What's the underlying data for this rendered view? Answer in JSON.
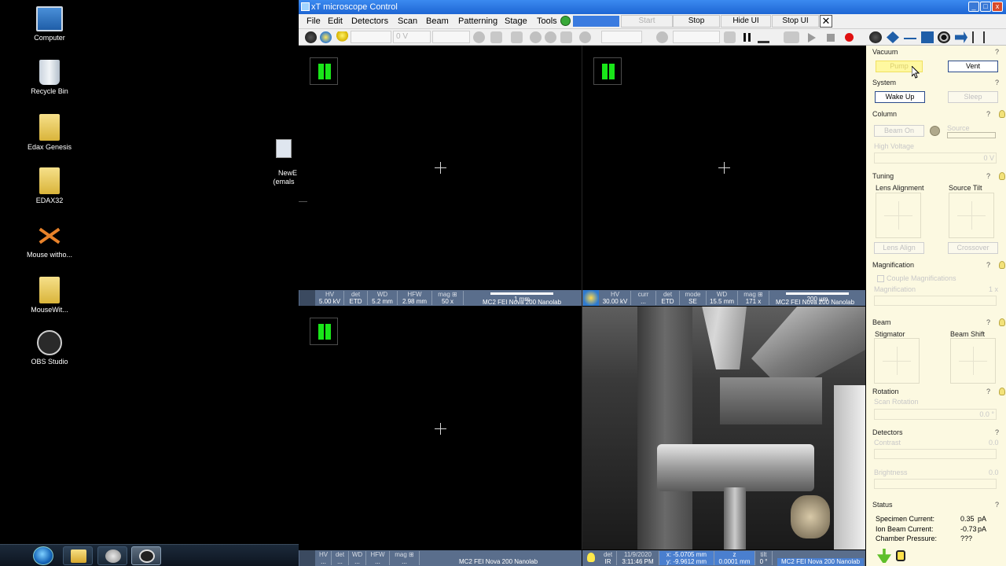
{
  "desktop": {
    "icons": [
      {
        "label": "Computer"
      },
      {
        "label": "Recycle Bin"
      },
      {
        "label": "Edax Genesis"
      },
      {
        "label": "EDAX32"
      },
      {
        "label": "Mouse witho..."
      },
      {
        "label": "MouseWit..."
      },
      {
        "label": "OBS Studio"
      }
    ],
    "partial_icon_label": "NewE\n(emals"
  },
  "window": {
    "title": "xT microscope Control"
  },
  "menu": {
    "items": [
      "File",
      "Edit",
      "Detectors",
      "Scan",
      "Beam",
      "Patterning",
      "Stage",
      "Tools"
    ],
    "buttons": [
      "Start",
      "Stop",
      "Hide UI",
      "Stop UI"
    ],
    "close": "✕"
  },
  "toolbar": {
    "hv_value": "0 V"
  },
  "quad1": {
    "databar": [
      {
        "k": "HV",
        "v": "5.00 kV"
      },
      {
        "k": "det",
        "v": "ETD"
      },
      {
        "k": "WD",
        "v": "5.2 mm"
      },
      {
        "k": "HFW",
        "v": "2.98 mm"
      },
      {
        "k": "mag ⊞",
        "v": "50 x"
      }
    ],
    "scale": "1 mm",
    "name": "MC2 FEI Nova 200 Nanolab"
  },
  "quad2": {
    "databar": [
      {
        "k": "HV",
        "v": "30.00 kV"
      },
      {
        "k": "curr",
        "v": "..."
      },
      {
        "k": "det",
        "v": "ETD"
      },
      {
        "k": "mode",
        "v": "SE"
      },
      {
        "k": "WD",
        "v": "15.5 mm"
      },
      {
        "k": "mag ⊞",
        "v": "171 x"
      }
    ],
    "scale": "200 µm",
    "name": "MC2 FEI Nova 200 Nanolab"
  },
  "quad3": {
    "databar": [
      {
        "k": "HV",
        "v": "..."
      },
      {
        "k": "det",
        "v": "..."
      },
      {
        "k": "WD",
        "v": "..."
      },
      {
        "k": "HFW",
        "v": "..."
      },
      {
        "k": "mag ⊞",
        "v": "..."
      }
    ],
    "name": "MC2 FEI Nova 200 Nanolab"
  },
  "quad4": {
    "databar": [
      {
        "k": "det",
        "v": "IR"
      },
      {
        "k": "11/9/2020",
        "v": "3:11:46 PM"
      },
      {
        "k": "x: -5.0705 mm",
        "v": "y: -9.9612 mm"
      },
      {
        "k": "z",
        "v": "0.0001 mm"
      },
      {
        "k": "tilt",
        "v": "0 °"
      }
    ],
    "name": "MC2 FEI Nova 200 Nanolab"
  },
  "panel": {
    "vacuum": {
      "title": "Vacuum",
      "pump": "Pump",
      "vent": "Vent"
    },
    "system": {
      "title": "System",
      "wake": "Wake Up",
      "sleep": "Sleep"
    },
    "column": {
      "title": "Column",
      "beam_on": "Beam On",
      "source": "Source",
      "high_voltage": "High Voltage",
      "hv_value": "0 V"
    },
    "tuning": {
      "title": "Tuning",
      "lens_alignment": "Lens Alignment",
      "source_tilt": "Source Tilt",
      "lens_align": "Lens Align",
      "crossover": "Crossover"
    },
    "magnification": {
      "title": "Magnification",
      "couple": "Couple Magnifications",
      "label": "Magnification",
      "value": "1 x"
    },
    "beam": {
      "title": "Beam",
      "stigmator": "Stigmator",
      "beam_shift": "Beam Shift"
    },
    "rotation": {
      "title": "Rotation",
      "scan_rotation": "Scan Rotation",
      "value": "0.0 °"
    },
    "detectors": {
      "title": "Detectors",
      "contrast": "Contrast",
      "contrast_value": "0.0",
      "brightness": "Brightness",
      "brightness_value": "0.0"
    },
    "status": {
      "title": "Status",
      "rows": [
        {
          "label": "Specimen Current:",
          "value": "0.35",
          "unit": "pA"
        },
        {
          "label": "Ion Beam Current:",
          "value": "-0.73",
          "unit": "pA"
        },
        {
          "label": "Chamber Pressure:",
          "value": "???",
          "unit": ""
        }
      ]
    },
    "help": "?"
  }
}
